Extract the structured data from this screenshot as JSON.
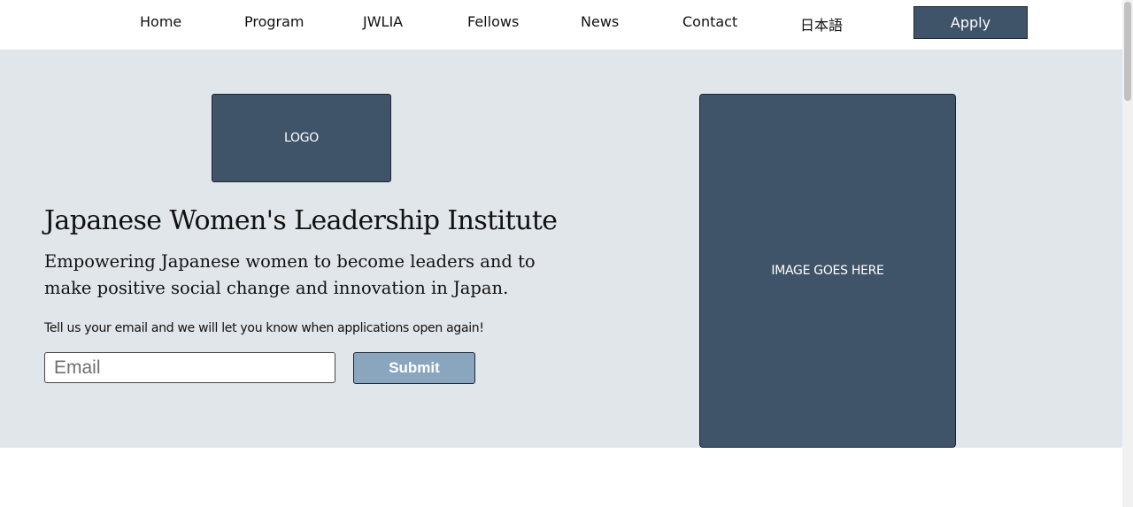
{
  "nav": {
    "items": [
      {
        "label": "Home"
      },
      {
        "label": "Program"
      },
      {
        "label": "JWLIA"
      },
      {
        "label": "Fellows"
      },
      {
        "label": "News"
      },
      {
        "label": "Contact"
      },
      {
        "label": "日本語"
      }
    ],
    "apply_label": "Apply"
  },
  "hero": {
    "logo_text": "LOGO",
    "title": "Japanese Women's Leadership Institute",
    "subtitle": "Empowering Japanese women to become leaders and to make positive social change and innovation in Japan.",
    "prompt": "Tell us your email and we will let you know when applications open again!",
    "email_placeholder": "Email",
    "submit_label": "Submit",
    "image_text": "IMAGE GOES HERE"
  },
  "colors": {
    "accent": "#3f5469",
    "hero_background": "#e1e6ea",
    "submit": "#8aa6be"
  }
}
